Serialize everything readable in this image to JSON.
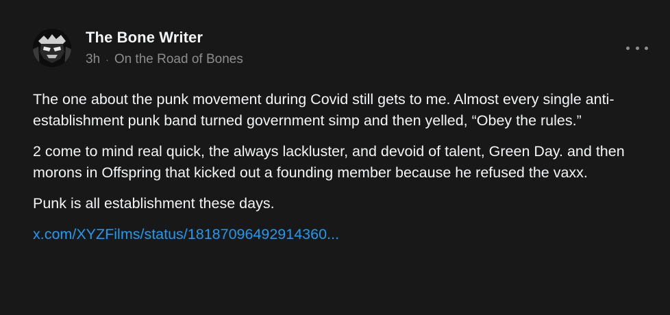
{
  "post": {
    "author": "The Bone Writer",
    "time": "3h",
    "separator": "·",
    "publication": "On the Road of Bones",
    "paragraphs": [
      "The one about the punk movement during Covid still gets to me. Almost every single anti-establishment punk band turned government simp and then yelled, “Obey the rules.”",
      "2 come to mind real quick, the always lackluster, and devoid of talent, Green Day. and then morons in Offspring that kicked out a founding member because he refused the vaxx.",
      "Punk is all establishment these days."
    ],
    "link_text": "x.com/XYZFilms/status/18187096492914360..."
  },
  "icons": {
    "avatar": "author-avatar",
    "more": "more-options-icon"
  },
  "colors": {
    "background": "#181818",
    "text": "#f3f5f7",
    "muted": "#8d8d8d",
    "link": "#1e9bf0"
  }
}
